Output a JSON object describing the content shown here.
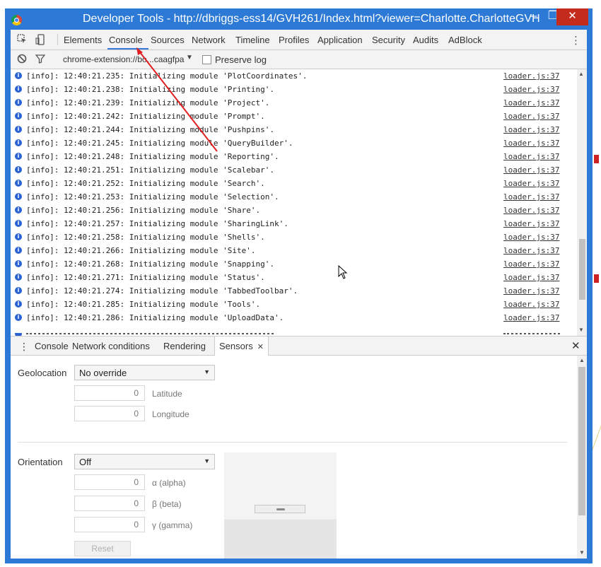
{
  "window": {
    "title": "Developer Tools - http://dbriggs-ess14/GVH261/Index.html?viewer=Charlotte.CharlotteGVH",
    "controls": {
      "minimize": "–",
      "maximize": "❐",
      "close": "✕"
    }
  },
  "toolbar": {
    "tabs": [
      {
        "label": "Elements"
      },
      {
        "label": "Console"
      },
      {
        "label": "Sources"
      },
      {
        "label": "Network"
      },
      {
        "label": "Timeline"
      },
      {
        "label": "Profiles"
      },
      {
        "label": "Application"
      },
      {
        "label": "Security"
      },
      {
        "label": "Audits"
      },
      {
        "label": "AdBlock"
      }
    ],
    "active_tab": "Console"
  },
  "filter_bar": {
    "context": "chrome-extension://bo...caagfpa",
    "preserve_log_label": "Preserve log",
    "preserve_log_checked": false
  },
  "console": {
    "rows": [
      {
        "msg": "[info]: 12:40:21.235: Initializing module 'PlotCoordinates'.",
        "src": "loader.js:37"
      },
      {
        "msg": "[info]: 12:40:21.238: Initializing module 'Printing'.",
        "src": "loader.js:37"
      },
      {
        "msg": "[info]: 12:40:21.239: Initializing module 'Project'.",
        "src": "loader.js:37"
      },
      {
        "msg": "[info]: 12:40:21.242: Initializing module 'Prompt'.",
        "src": "loader.js:37"
      },
      {
        "msg": "[info]: 12:40:21.244: Initializing module 'Pushpins'.",
        "src": "loader.js:37"
      },
      {
        "msg": "[info]: 12:40:21.245: Initializing module 'QueryBuilder'.",
        "src": "loader.js:37"
      },
      {
        "msg": "[info]: 12:40:21.248: Initializing module 'Reporting'.",
        "src": "loader.js:37"
      },
      {
        "msg": "[info]: 12:40:21.251: Initializing module 'Scalebar'.",
        "src": "loader.js:37"
      },
      {
        "msg": "[info]: 12:40:21.252: Initializing module 'Search'.",
        "src": "loader.js:37"
      },
      {
        "msg": "[info]: 12:40:21.253: Initializing module 'Selection'.",
        "src": "loader.js:37"
      },
      {
        "msg": "[info]: 12:40:21.256: Initializing module 'Share'.",
        "src": "loader.js:37"
      },
      {
        "msg": "[info]: 12:40:21.257: Initializing module 'SharingLink'.",
        "src": "loader.js:37"
      },
      {
        "msg": "[info]: 12:40:21.258: Initializing module 'Shells'.",
        "src": "loader.js:37"
      },
      {
        "msg": "[info]: 12:40:21.266: Initializing module 'Site'.",
        "src": "loader.js:37"
      },
      {
        "msg": "[info]: 12:40:21.268: Initializing module 'Snapping'.",
        "src": "loader.js:37"
      },
      {
        "msg": "[info]: 12:40:21.271: Initializing module 'Status'.",
        "src": "loader.js:37"
      },
      {
        "msg": "[info]: 12:40:21.274: Initializing module 'TabbedToolbar'.",
        "src": "loader.js:37"
      },
      {
        "msg": "[info]: 12:40:21.285: Initializing module 'Tools'.",
        "src": "loader.js:37"
      },
      {
        "msg": "[info]: 12:40:21.286: Initializing module 'UploadData'.",
        "src": "loader.js:37"
      }
    ]
  },
  "drawer": {
    "tabs": [
      {
        "label": "Console"
      },
      {
        "label": "Network conditions"
      },
      {
        "label": "Rendering"
      },
      {
        "label": "Sensors"
      }
    ],
    "active_tab": "Sensors"
  },
  "sensors": {
    "geolocation_label": "Geolocation",
    "geolocation_value": "No override",
    "latitude_value": "0",
    "latitude_label": "Latitude",
    "longitude_value": "0",
    "longitude_label": "Longitude",
    "orientation_label": "Orientation",
    "orientation_value": "Off",
    "alpha_value": "0",
    "alpha_label": "α (alpha)",
    "beta_value": "0",
    "beta_label": "β (beta)",
    "gamma_value": "0",
    "gamma_label": "γ (gamma)",
    "reset_label": "Reset"
  },
  "colors": {
    "title_bar": "#2d7ad6",
    "close_button": "#c42b1c",
    "active_tab_underline": "#3879d9",
    "annotation_arrow": "#e02020",
    "info_icon": "#2a62d4"
  },
  "icons": {
    "inspect": "inspect-element-icon",
    "device": "device-mode-icon",
    "clear": "clear-console-icon",
    "filter": "filter-icon"
  }
}
